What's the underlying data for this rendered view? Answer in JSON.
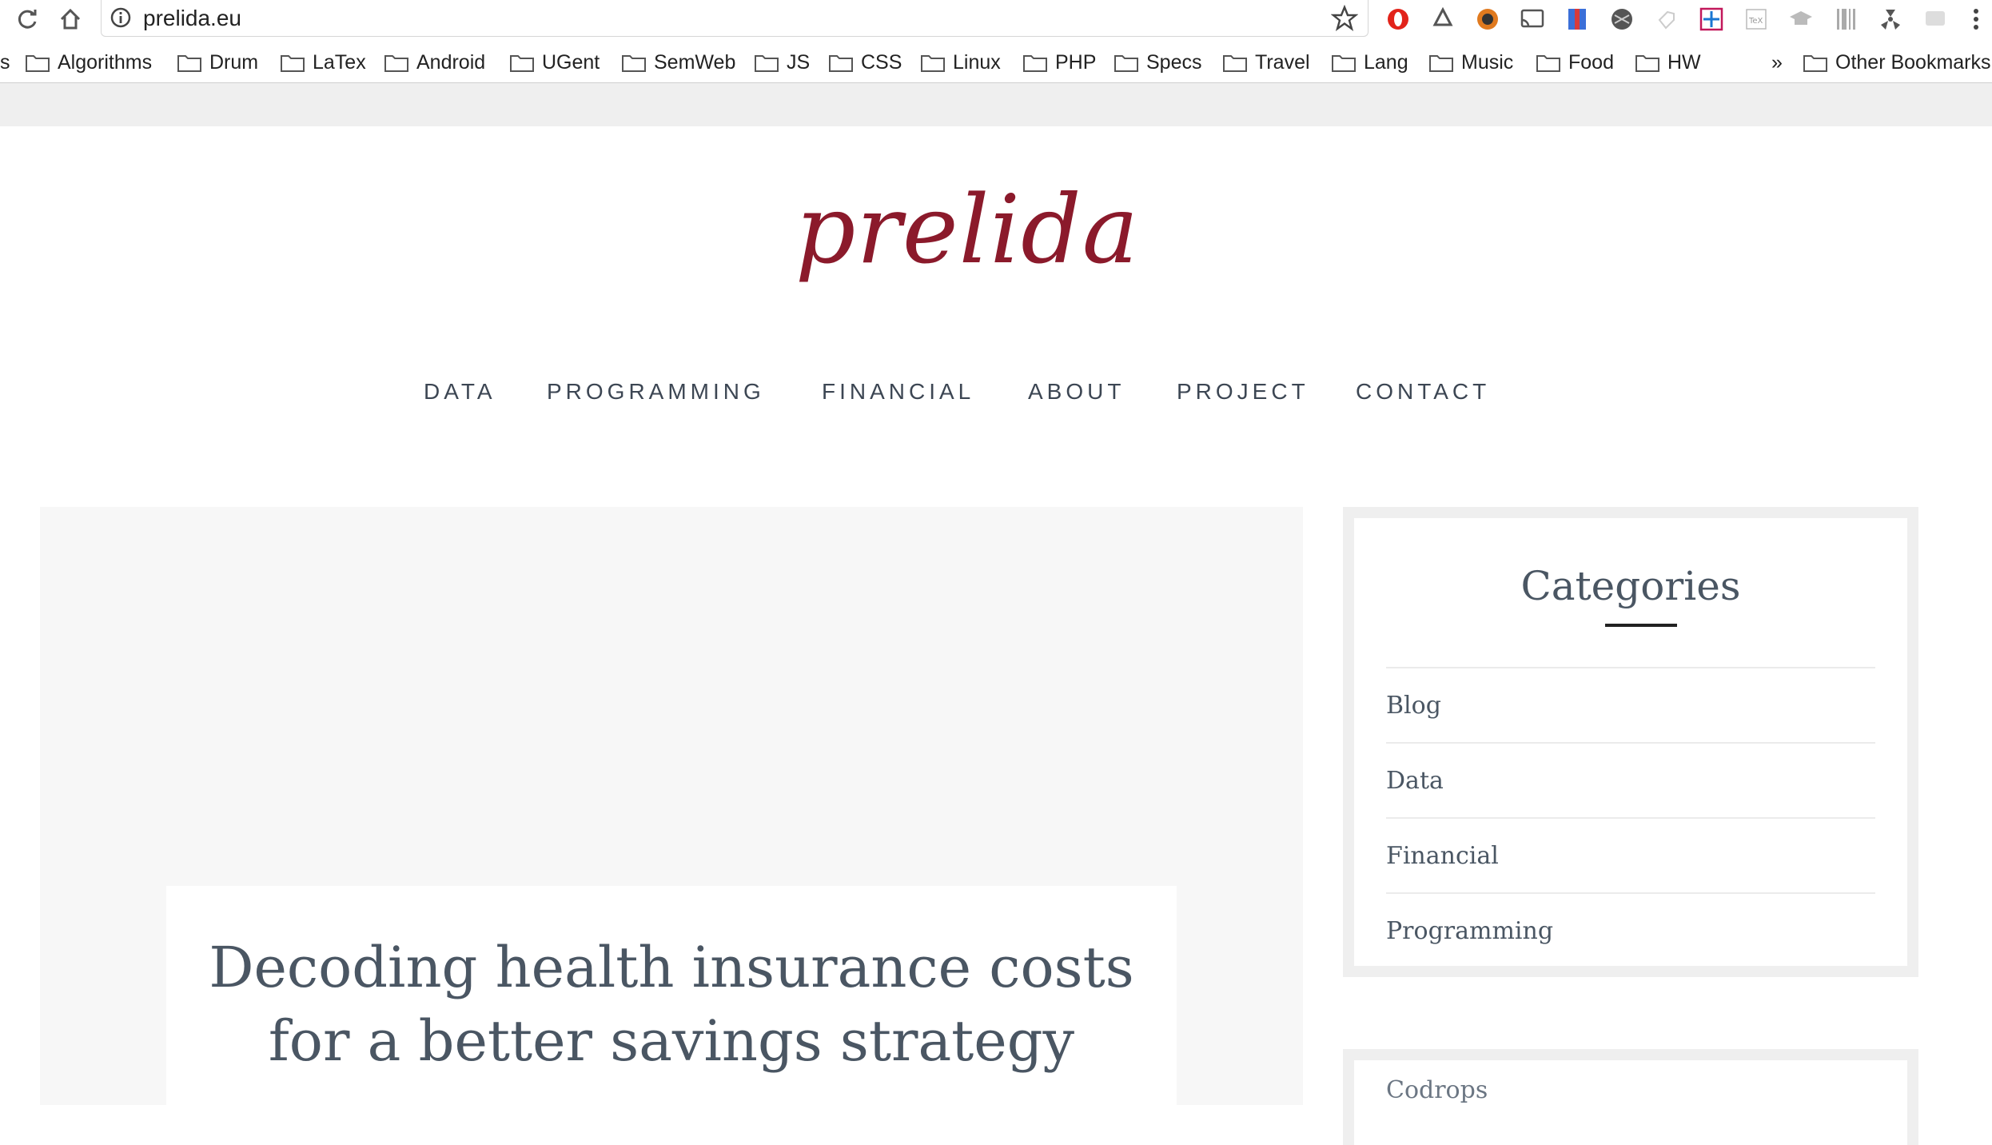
{
  "browser": {
    "url": "prelida.eu",
    "bookmarks": [
      "Algorithms",
      "Drum",
      "LaTex",
      "Android",
      "UGent",
      "SemWeb",
      "JS",
      "CSS",
      "Linux",
      "PHP",
      "Specs",
      "Travel",
      "Lang",
      "Music",
      "Food",
      "HW"
    ],
    "more_chevron": "»",
    "other_bookmarks": "Other Bookmarks",
    "extensions": [
      "opera-ext-icon",
      "recycle-icon",
      "coin-icon",
      "cast-icon",
      "bookmark-ext-icon",
      "globe-icon",
      "tag-icon",
      "move-icon",
      "tex-icon",
      "graduation-cap-icon",
      "barcode-icon",
      "radiation-icon",
      "screen-icon"
    ]
  },
  "site": {
    "logo": "prelida",
    "nav": [
      "DATA",
      "PROGRAMMING",
      "FINANCIAL",
      "ABOUT",
      "PROJECT",
      "CONTACT"
    ],
    "accent_color": "#8b1a2b"
  },
  "post": {
    "title": "Decoding health insurance costs for a better savings strategy"
  },
  "sidebar": {
    "categories_title": "Categories",
    "categories": [
      "Blog",
      "Data",
      "Financial",
      "Programming"
    ],
    "next_widget_text": "Codrops"
  }
}
